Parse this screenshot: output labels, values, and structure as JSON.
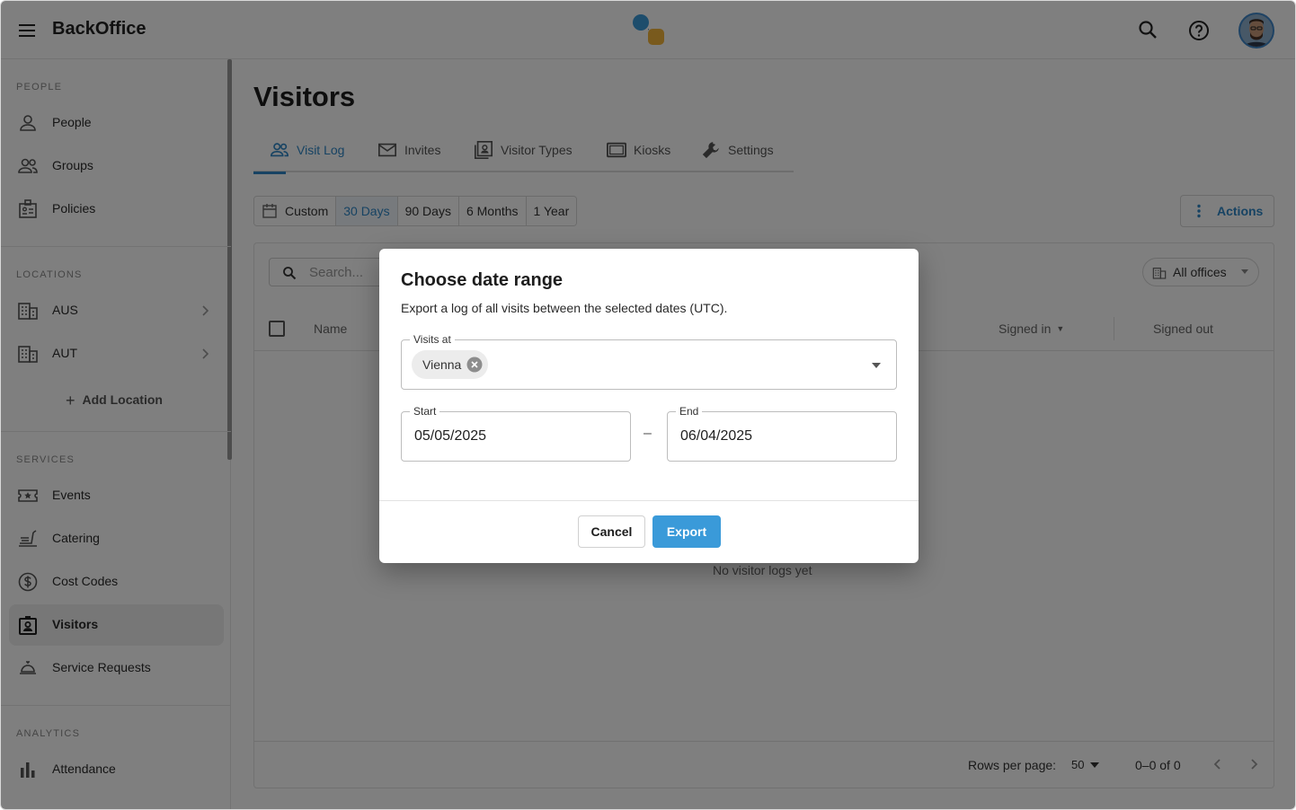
{
  "app": {
    "brand": "BackOffice"
  },
  "sidebar": {
    "sections": {
      "people": "PEOPLE",
      "locations": "LOCATIONS",
      "services": "SERVICES",
      "analytics": "ANALYTICS"
    },
    "people_items": [
      {
        "label": "People",
        "icon": "person-icon"
      },
      {
        "label": "Groups",
        "icon": "group-icon"
      },
      {
        "label": "Policies",
        "icon": "policy-icon"
      }
    ],
    "location_items": [
      {
        "label": "AUS",
        "icon": "building-icon"
      },
      {
        "label": "AUT",
        "icon": "building-icon"
      }
    ],
    "add_location": "Add Location",
    "service_items": [
      {
        "label": "Events",
        "icon": "ticket-icon"
      },
      {
        "label": "Catering",
        "icon": "catering-icon"
      },
      {
        "label": "Cost Codes",
        "icon": "dollar-icon"
      },
      {
        "label": "Visitors",
        "icon": "visitor-badge-icon",
        "active": true
      },
      {
        "label": "Service Requests",
        "icon": "service-bell-icon"
      }
    ],
    "analytics_items": [
      {
        "label": "Attendance",
        "icon": "bar-chart-icon"
      }
    ]
  },
  "main": {
    "title": "Visitors",
    "tabs": [
      {
        "label": "Visit Log",
        "active": true
      },
      {
        "label": "Invites"
      },
      {
        "label": "Visitor Types"
      },
      {
        "label": "Kiosks"
      },
      {
        "label": "Settings"
      }
    ],
    "ranges": [
      "Custom",
      "30 Days",
      "90 Days",
      "6 Months",
      "1 Year"
    ],
    "active_range": "30 Days",
    "actions_label": "Actions",
    "search_placeholder": "Search...",
    "offices_filter": "All offices",
    "columns": {
      "name": "Name",
      "signed_in": "Signed in",
      "signed_out": "Signed out"
    },
    "empty_message": "No visitor logs yet",
    "footer": {
      "rows_per_page_label": "Rows per page:",
      "rows_per_page": "50",
      "count": "0–0 of 0"
    }
  },
  "dialog": {
    "title": "Choose date range",
    "description": "Export a log of all visits between the selected dates (UTC).",
    "visits_at_label": "Visits at",
    "visits_at_chip": "Vienna",
    "start_label": "Start",
    "start_value": "05/05/2025",
    "separator": "–",
    "end_label": "End",
    "end_value": "06/04/2025",
    "cancel_label": "Cancel",
    "export_label": "Export"
  },
  "colors": {
    "accent": "#2f87c6",
    "export_button": "#3a9ad9",
    "overlay": "rgba(0,0,0,0.5)"
  }
}
